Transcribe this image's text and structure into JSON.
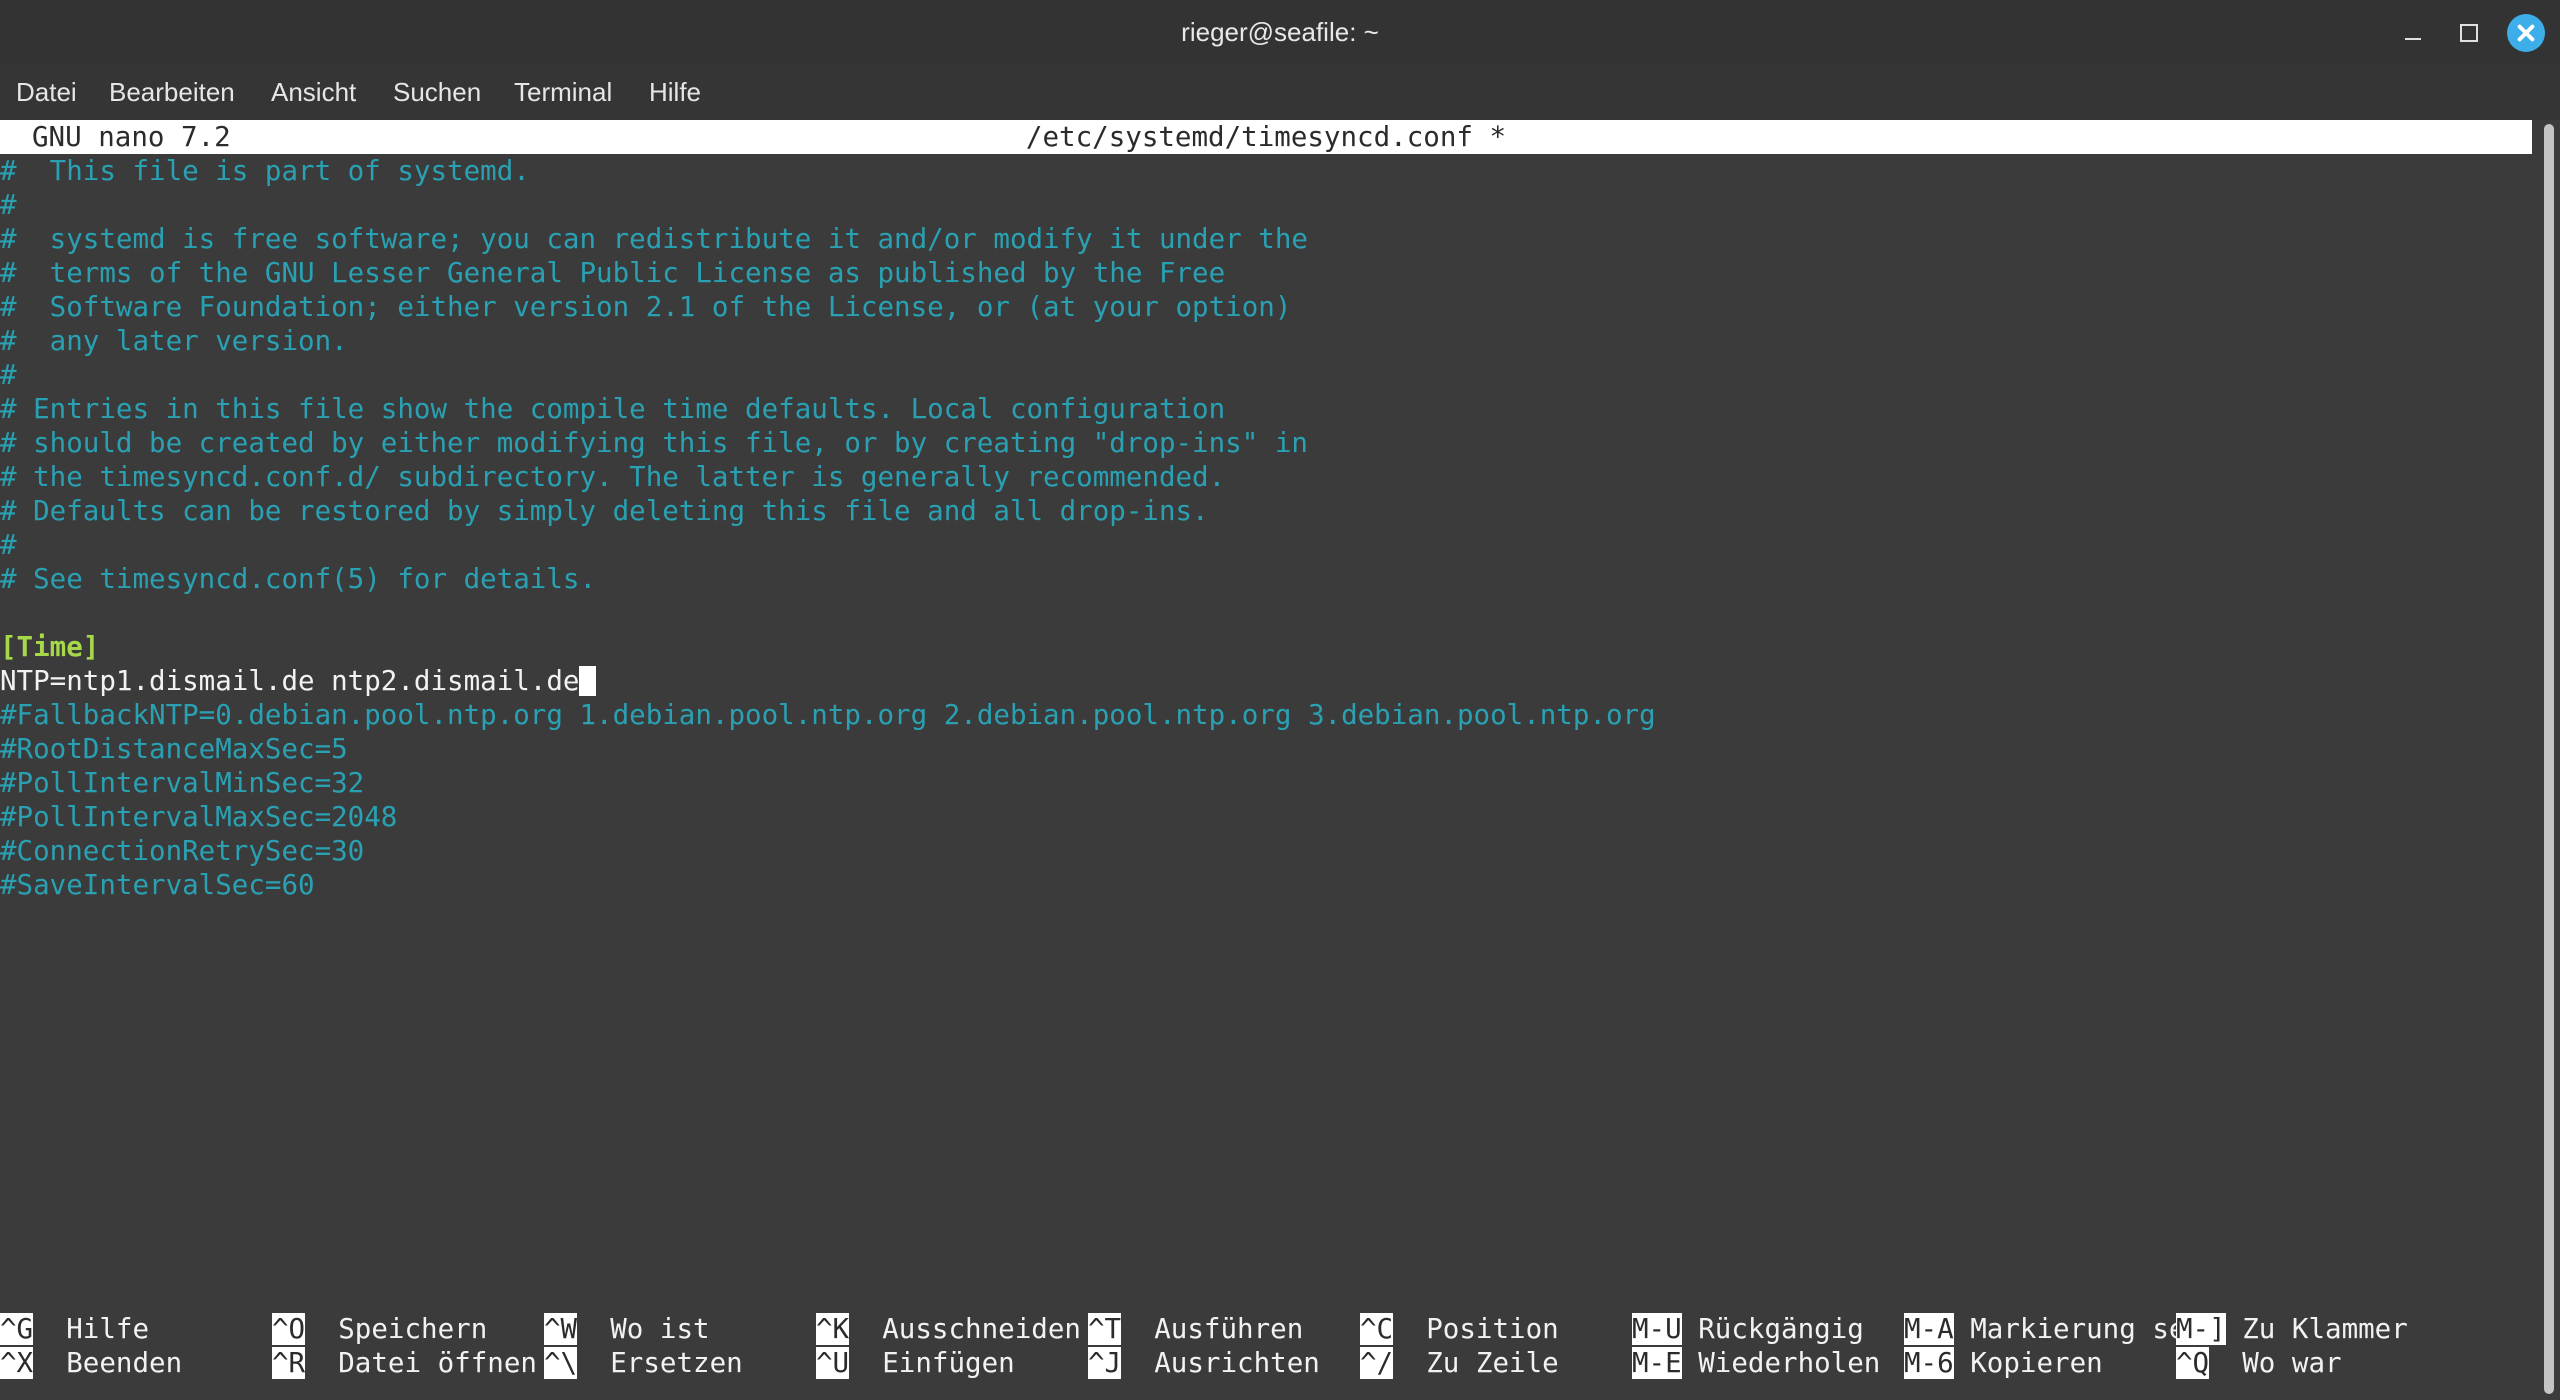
{
  "window": {
    "title": "rieger@seafile: ~",
    "buttons": [
      "minimize",
      "maximize",
      "close"
    ]
  },
  "menubar": {
    "items": [
      "Datei",
      "Bearbeiten",
      "Ansicht",
      "Suchen",
      "Terminal",
      "Hilfe"
    ]
  },
  "nano": {
    "version": "GNU nano 7.2",
    "filename": "/etc/systemd/timesyncd.conf *",
    "lines": [
      {
        "type": "comment",
        "text": "#  This file is part of systemd."
      },
      {
        "type": "comment",
        "text": "#"
      },
      {
        "type": "comment",
        "text": "#  systemd is free software; you can redistribute it and/or modify it under the"
      },
      {
        "type": "comment",
        "text": "#  terms of the GNU Lesser General Public License as published by the Free"
      },
      {
        "type": "comment",
        "text": "#  Software Foundation; either version 2.1 of the License, or (at your option)"
      },
      {
        "type": "comment",
        "text": "#  any later version."
      },
      {
        "type": "comment",
        "text": "#"
      },
      {
        "type": "comment",
        "text": "# Entries in this file show the compile time defaults. Local configuration"
      },
      {
        "type": "comment",
        "text": "# should be created by either modifying this file, or by creating \"drop-ins\" in"
      },
      {
        "type": "comment",
        "text": "# the timesyncd.conf.d/ subdirectory. The latter is generally recommended."
      },
      {
        "type": "comment",
        "text": "# Defaults can be restored by simply deleting this file and all drop-ins."
      },
      {
        "type": "comment",
        "text": "#"
      },
      {
        "type": "comment",
        "text": "# See timesyncd.conf(5) for details."
      },
      {
        "type": "plain",
        "text": ""
      },
      {
        "type": "section",
        "text": "[Time]"
      },
      {
        "type": "plain",
        "text": "NTP=ntp1.dismail.de ntp2.dismail.de",
        "cursor": true
      },
      {
        "type": "comment",
        "text": "#FallbackNTP=0.debian.pool.ntp.org 1.debian.pool.ntp.org 2.debian.pool.ntp.org 3.debian.pool.ntp.org"
      },
      {
        "type": "comment",
        "text": "#RootDistanceMaxSec=5"
      },
      {
        "type": "comment",
        "text": "#PollIntervalMinSec=32"
      },
      {
        "type": "comment",
        "text": "#PollIntervalMaxSec=2048"
      },
      {
        "type": "comment",
        "text": "#ConnectionRetrySec=30"
      },
      {
        "type": "comment",
        "text": "#SaveIntervalSec=60"
      }
    ],
    "shortcuts": [
      [
        {
          "key": "^G",
          "label": "Hilfe"
        },
        {
          "key": "^O",
          "label": "Speichern"
        },
        {
          "key": "^W",
          "label": "Wo ist"
        },
        {
          "key": "^K",
          "label": "Ausschneiden"
        },
        {
          "key": "^T",
          "label": "Ausführen"
        },
        {
          "key": "^C",
          "label": "Position"
        },
        {
          "key": "M-U",
          "label": "Rückgängig"
        },
        {
          "key": "M-A",
          "label": "Markierung se"
        },
        {
          "key": "M-]",
          "label": "Zu Klammer"
        }
      ],
      [
        {
          "key": "^X",
          "label": "Beenden"
        },
        {
          "key": "^R",
          "label": "Datei öffnen"
        },
        {
          "key": "^\\",
          "label": "Ersetzen"
        },
        {
          "key": "^U",
          "label": "Einfügen"
        },
        {
          "key": "^J",
          "label": "Ausrichten"
        },
        {
          "key": "^/",
          "label": "Zu Zeile"
        },
        {
          "key": "M-E",
          "label": "Wiederholen"
        },
        {
          "key": "M-6",
          "label": "Kopieren"
        },
        {
          "key": "^Q",
          "label": "Wo war"
        }
      ]
    ]
  }
}
